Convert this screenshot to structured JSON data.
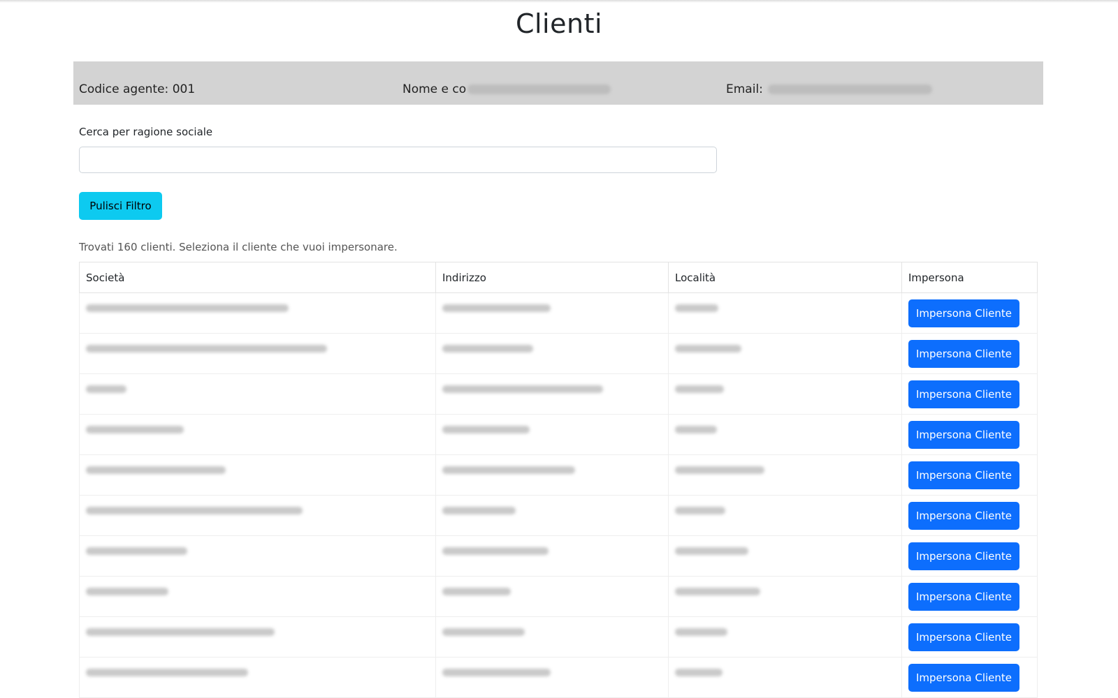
{
  "page": {
    "title": "Clienti"
  },
  "agent": {
    "code_label": "Codice agente: 001",
    "name_label": "Nome e co",
    "email_label": "Email:"
  },
  "search": {
    "label": "Cerca per ragione sociale",
    "value": "",
    "placeholder": "",
    "clear_button": "Pulisci Filtro"
  },
  "results": {
    "summary": "Trovati 160 clienti. Seleziona il cliente che vuoi impersonare."
  },
  "table": {
    "columns": [
      "Società",
      "Indirizzo",
      "Località",
      "Impersona"
    ],
    "row_button_label": "Impersona Cliente"
  },
  "colors": {
    "agent_bar_bg": "#d3d3d3",
    "clear_button_bg": "#0dcaf0",
    "impersonate_button_bg": "#0d6efd"
  }
}
